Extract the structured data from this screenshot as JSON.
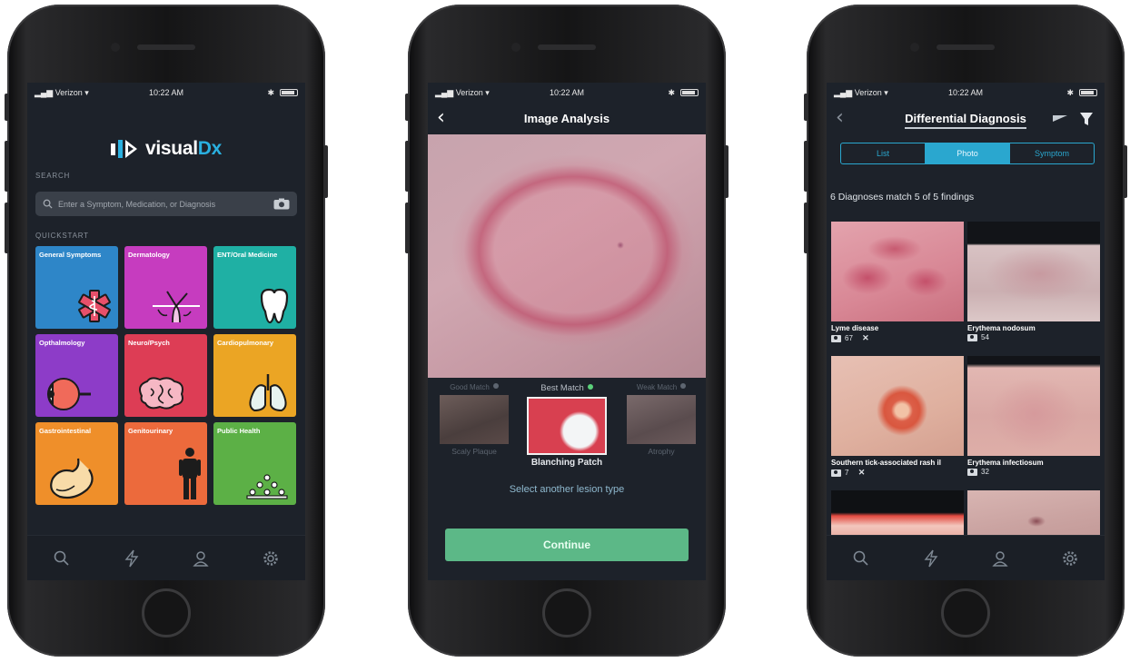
{
  "status_bar": {
    "carrier": "Verizon",
    "time": "10:22 AM"
  },
  "phone1": {
    "logo": {
      "visual": "visual",
      "dx": "Dx"
    },
    "search_label": "SEARCH",
    "search_placeholder": "Enter a Symptom, Medication, or Diagnosis",
    "quickstart_label": "QUICKSTART",
    "tiles": [
      {
        "label": "General Symptoms",
        "color": "#2e86c8",
        "icon": "star-of-life-icon"
      },
      {
        "label": "Dermatology",
        "color": "#c63cbf",
        "icon": "hair-follicle-icon"
      },
      {
        "label": "ENT/Oral Medicine",
        "color": "#1fb0a4",
        "icon": "tooth-icon"
      },
      {
        "label": "Opthalmology",
        "color": "#8d3cc8",
        "icon": "eye-icon"
      },
      {
        "label": "Neuro/Psych",
        "color": "#dd3d55",
        "icon": "brain-icon"
      },
      {
        "label": "Cardiopulmonary",
        "color": "#eba524",
        "icon": "lungs-icon"
      },
      {
        "label": "Gastrointestinal",
        "color": "#ef8f2a",
        "icon": "stomach-icon"
      },
      {
        "label": "Genitourinary",
        "color": "#ec6a3c",
        "icon": "human-figure-icon"
      },
      {
        "label": "Public Health",
        "color": "#5cb046",
        "icon": "population-icon"
      }
    ]
  },
  "phone2": {
    "title": "Image Analysis",
    "matches": {
      "left": {
        "head": "Good Match",
        "name": "Scaly Plaque"
      },
      "center": {
        "head": "Best Match",
        "name": "Blanching Patch"
      },
      "right": {
        "head": "Weak Match",
        "name": "Atrophy"
      }
    },
    "select_other": "Select another lesion type",
    "continue_label": "Continue"
  },
  "phone3": {
    "title": "Differential Diagnosis",
    "segments": [
      "List",
      "Photo",
      "Symptom"
    ],
    "active_segment": "Photo",
    "match_count": "6 Diagnoses match 5 of 5 findings",
    "diagnoses": [
      {
        "name": "Lyme disease",
        "images": "67",
        "flag": "✕"
      },
      {
        "name": "Erythema nodosum",
        "images": "54",
        "flag": ""
      },
      {
        "name": "Southern tick-associated rash il",
        "images": "7",
        "flag": "✕"
      },
      {
        "name": "Erythema infectiosum",
        "images": "32",
        "flag": ""
      }
    ]
  },
  "accent_colors": {
    "continue": "#5cb887",
    "segment": "#2aa7cf",
    "best_match_dot": "#5bd07a"
  }
}
